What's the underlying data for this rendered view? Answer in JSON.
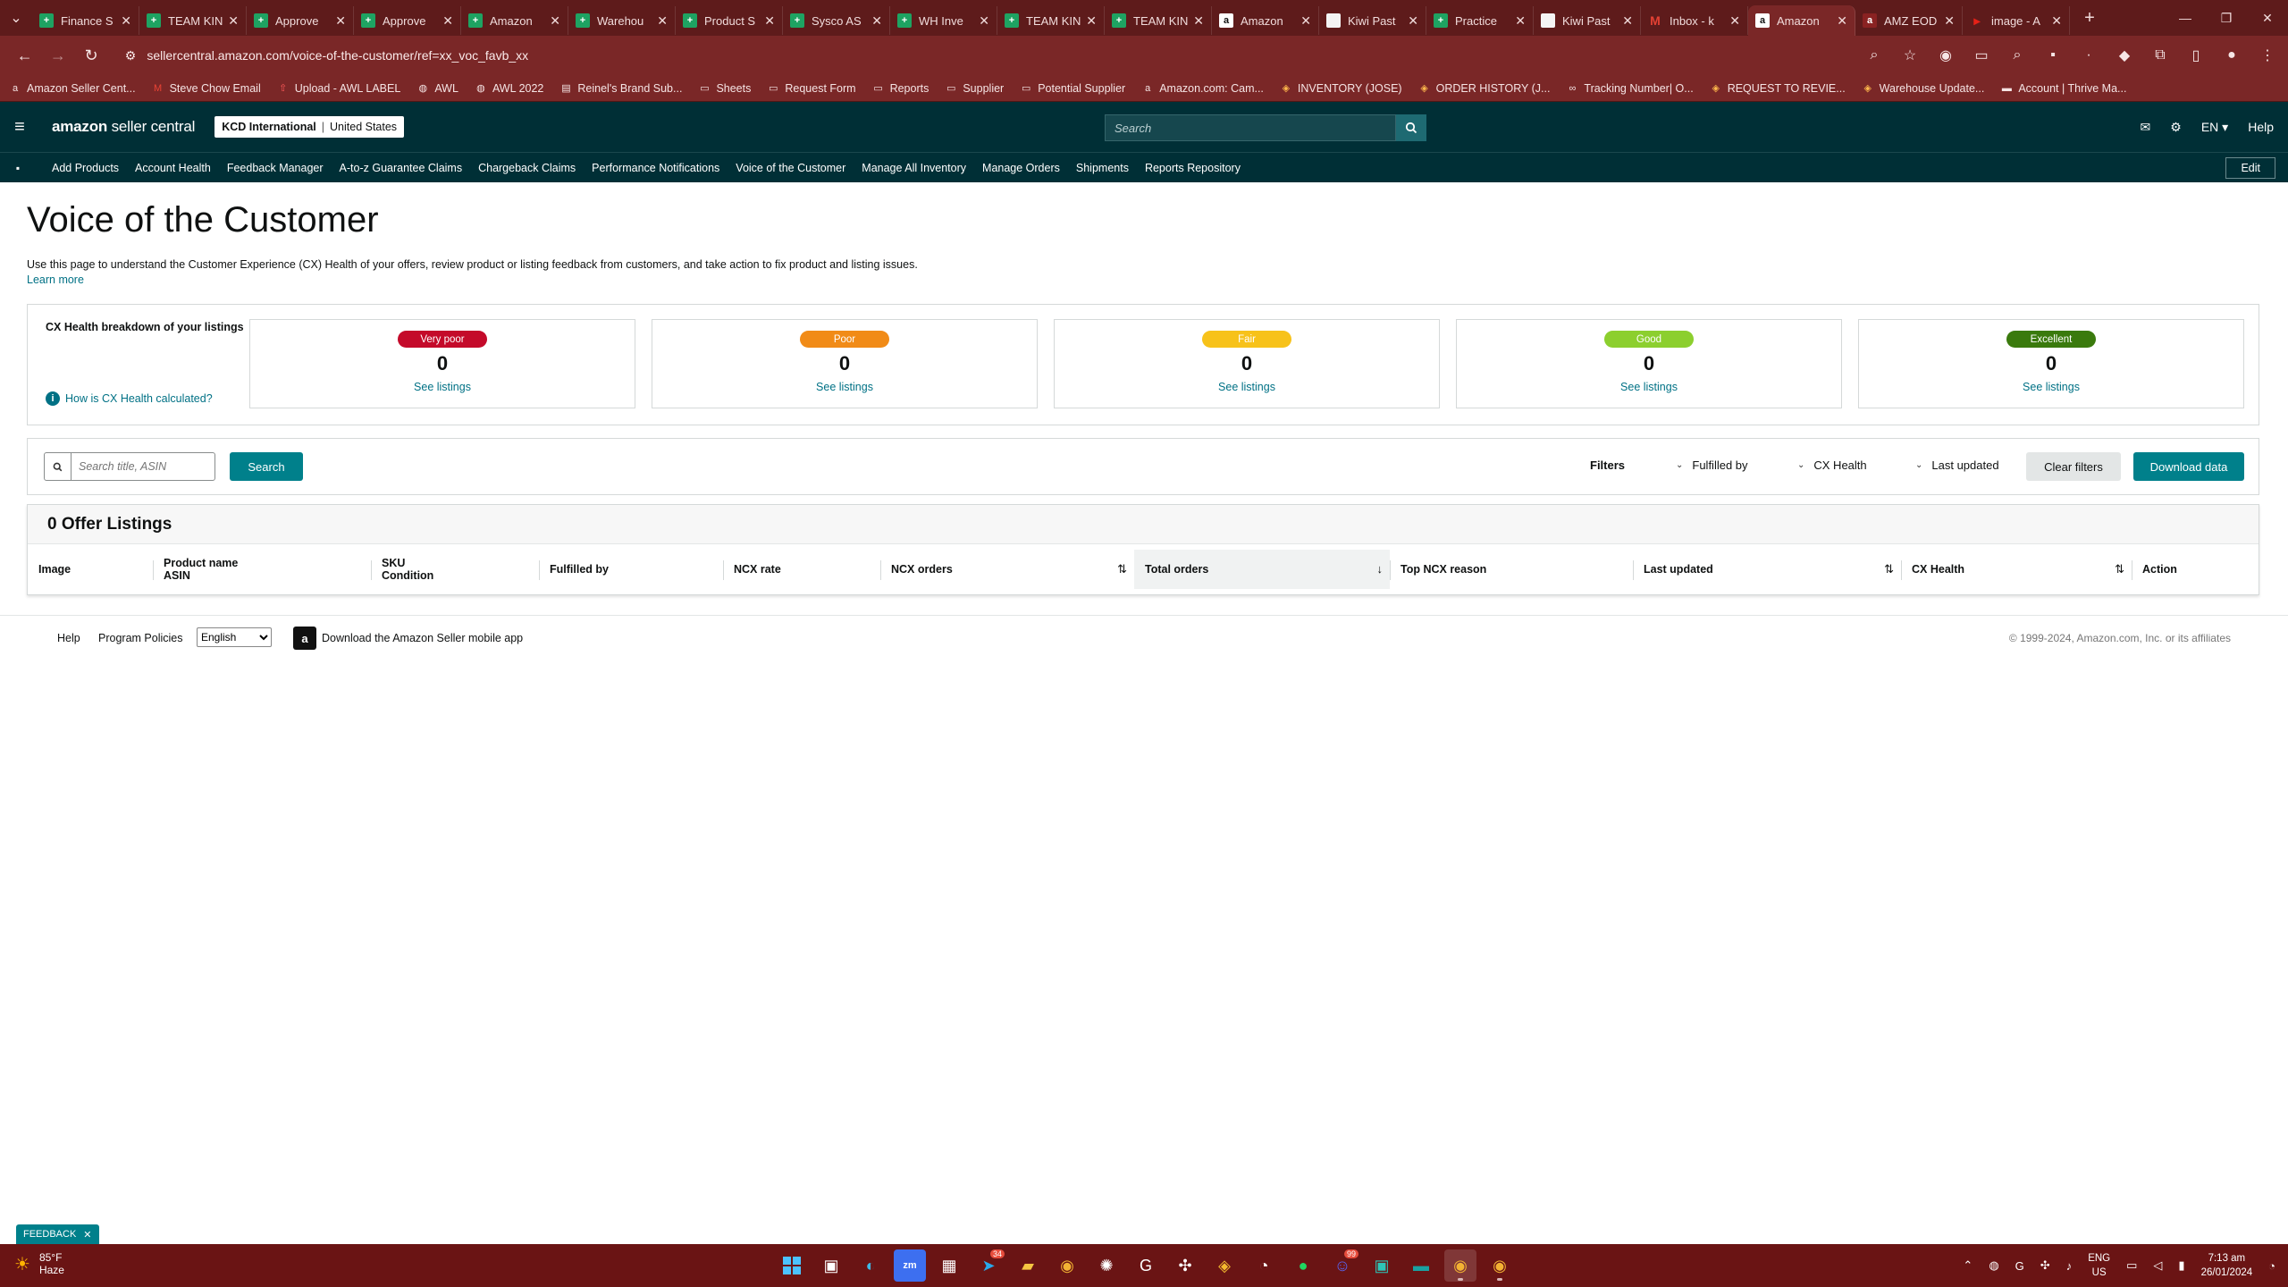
{
  "browser": {
    "tabs": [
      {
        "label": "Finance S",
        "icon": "sheets-icon"
      },
      {
        "label": "TEAM KIN",
        "icon": "sheets-icon"
      },
      {
        "label": "Approve",
        "icon": "sheets-icon"
      },
      {
        "label": "Approve",
        "icon": "sheets-icon"
      },
      {
        "label": "Amazon",
        "icon": "sheets-icon"
      },
      {
        "label": "Warehou",
        "icon": "sheets-icon"
      },
      {
        "label": "Product S",
        "icon": "sheets-icon"
      },
      {
        "label": "Sysco AS",
        "icon": "sheets-icon"
      },
      {
        "label": "WH Inve",
        "icon": "sheets-icon"
      },
      {
        "label": "TEAM KIN",
        "icon": "sheets-icon"
      },
      {
        "label": "TEAM KIN",
        "icon": "sheets-icon"
      },
      {
        "label": "Amazon",
        "icon": "amazon-icon"
      },
      {
        "label": "Kiwi Past",
        "icon": "doc-icon"
      },
      {
        "label": "Practice",
        "icon": "sheets-icon"
      },
      {
        "label": "Kiwi Past",
        "icon": "doc-icon"
      },
      {
        "label": "Inbox - k",
        "icon": "gmail-icon"
      },
      {
        "label": "Amazon",
        "icon": "amazon-icon"
      },
      {
        "label": "AMZ EOD",
        "icon": "amazon-red-icon"
      },
      {
        "label": "image - A",
        "icon": "youtube-icon"
      }
    ],
    "active_tab_index": 16,
    "url": "sellercentral.amazon.com/voice-of-the-customer/ref=xx_voc_favb_xx",
    "bookmarks": [
      {
        "label": "Amazon Seller Cent...",
        "icon": "amazon-icon"
      },
      {
        "label": "Steve Chow Email",
        "icon": "gmail-icon"
      },
      {
        "label": "Upload - AWL LABEL",
        "icon": "upload-icon"
      },
      {
        "label": "AWL",
        "icon": "globe-icon"
      },
      {
        "label": "AWL 2022",
        "icon": "globe-icon"
      },
      {
        "label": "Reinel's Brand Sub...",
        "icon": "doc-icon"
      },
      {
        "label": "Sheets",
        "icon": "folder-icon"
      },
      {
        "label": "Request Form",
        "icon": "folder-icon"
      },
      {
        "label": "Reports",
        "icon": "folder-icon"
      },
      {
        "label": "Supplier",
        "icon": "folder-icon"
      },
      {
        "label": "Potential Supplier",
        "icon": "folder-icon"
      },
      {
        "label": "Amazon.com: Cam...",
        "icon": "amazon-icon"
      },
      {
        "label": "INVENTORY (JOSE)",
        "icon": "sheets-icon"
      },
      {
        "label": "ORDER HISTORY (J...",
        "icon": "sheets-icon"
      },
      {
        "label": "Tracking Number| O...",
        "icon": "link-icon"
      },
      {
        "label": "REQUEST TO REVIE...",
        "icon": "sheets-icon"
      },
      {
        "label": "Warehouse Update...",
        "icon": "sheets-icon"
      },
      {
        "label": "Account | Thrive Ma...",
        "icon": "card-icon"
      }
    ]
  },
  "header": {
    "logo_bold": "amazon",
    "logo_light": " seller central",
    "account_name": "KCD International",
    "account_region": "United States",
    "search_placeholder": "Search",
    "language": "EN",
    "help": "Help"
  },
  "nav": {
    "items": [
      "Add Products",
      "Account Health",
      "Feedback Manager",
      "A-to-z Guarantee Claims",
      "Chargeback Claims",
      "Performance Notifications",
      "Voice of the Customer",
      "Manage All Inventory",
      "Manage Orders",
      "Shipments",
      "Reports Repository"
    ],
    "edit": "Edit"
  },
  "page": {
    "title": "Voice of the Customer",
    "intro": "Use this page to understand the Customer Experience (CX) Health of your offers, review product or listing feedback from customers, and take action to fix product and listing issues.",
    "learn_more": "Learn more"
  },
  "cx_health": {
    "title": "CX Health breakdown of your listings",
    "how_link": "How is CX Health calculated?",
    "cards": [
      {
        "label": "Very poor",
        "count": "0",
        "link": "See listings",
        "color": "#c40a2a"
      },
      {
        "label": "Poor",
        "count": "0",
        "link": "See listings",
        "color": "#f18b17"
      },
      {
        "label": "Fair",
        "count": "0",
        "link": "See listings",
        "color": "#f7c21a"
      },
      {
        "label": "Good",
        "count": "0",
        "link": "See listings",
        "color": "#8ccf2e"
      },
      {
        "label": "Excellent",
        "count": "0",
        "link": "See listings",
        "color": "#3a7a0d"
      }
    ]
  },
  "filters": {
    "search_placeholder": "Search title, ASIN",
    "search_button": "Search",
    "filters_label": "Filters",
    "fulfilled_by": "Fulfilled by",
    "cx_health": "CX Health",
    "last_updated": "Last updated",
    "clear": "Clear filters",
    "download": "Download data"
  },
  "listings": {
    "heading": "0 Offer Listings",
    "columns": {
      "image": "Image",
      "product_name": "Product name",
      "asin": "ASIN",
      "sku": "SKU",
      "condition": "Condition",
      "fulfilled_by": "Fulfilled by",
      "ncx_rate": "NCX rate",
      "ncx_orders": "NCX orders",
      "total_orders": "Total orders",
      "top_ncx_reason": "Top NCX reason",
      "last_updated": "Last updated",
      "cx_health": "CX Health",
      "action": "Action"
    }
  },
  "footer": {
    "help": "Help",
    "policies": "Program Policies",
    "language_selected": "English",
    "app": "Download the Amazon Seller mobile app",
    "copyright": "© 1999-2024, Amazon.com, Inc. or its affiliates"
  },
  "feedback_tab": "FEEDBACK",
  "taskbar": {
    "temperature": "85°F",
    "weather": "Haze",
    "lang_1": "ENG",
    "lang_2": "US",
    "time": "7:13 am",
    "date": "26/01/2024",
    "badges": {
      "telegram": "34",
      "discord": "99"
    }
  }
}
